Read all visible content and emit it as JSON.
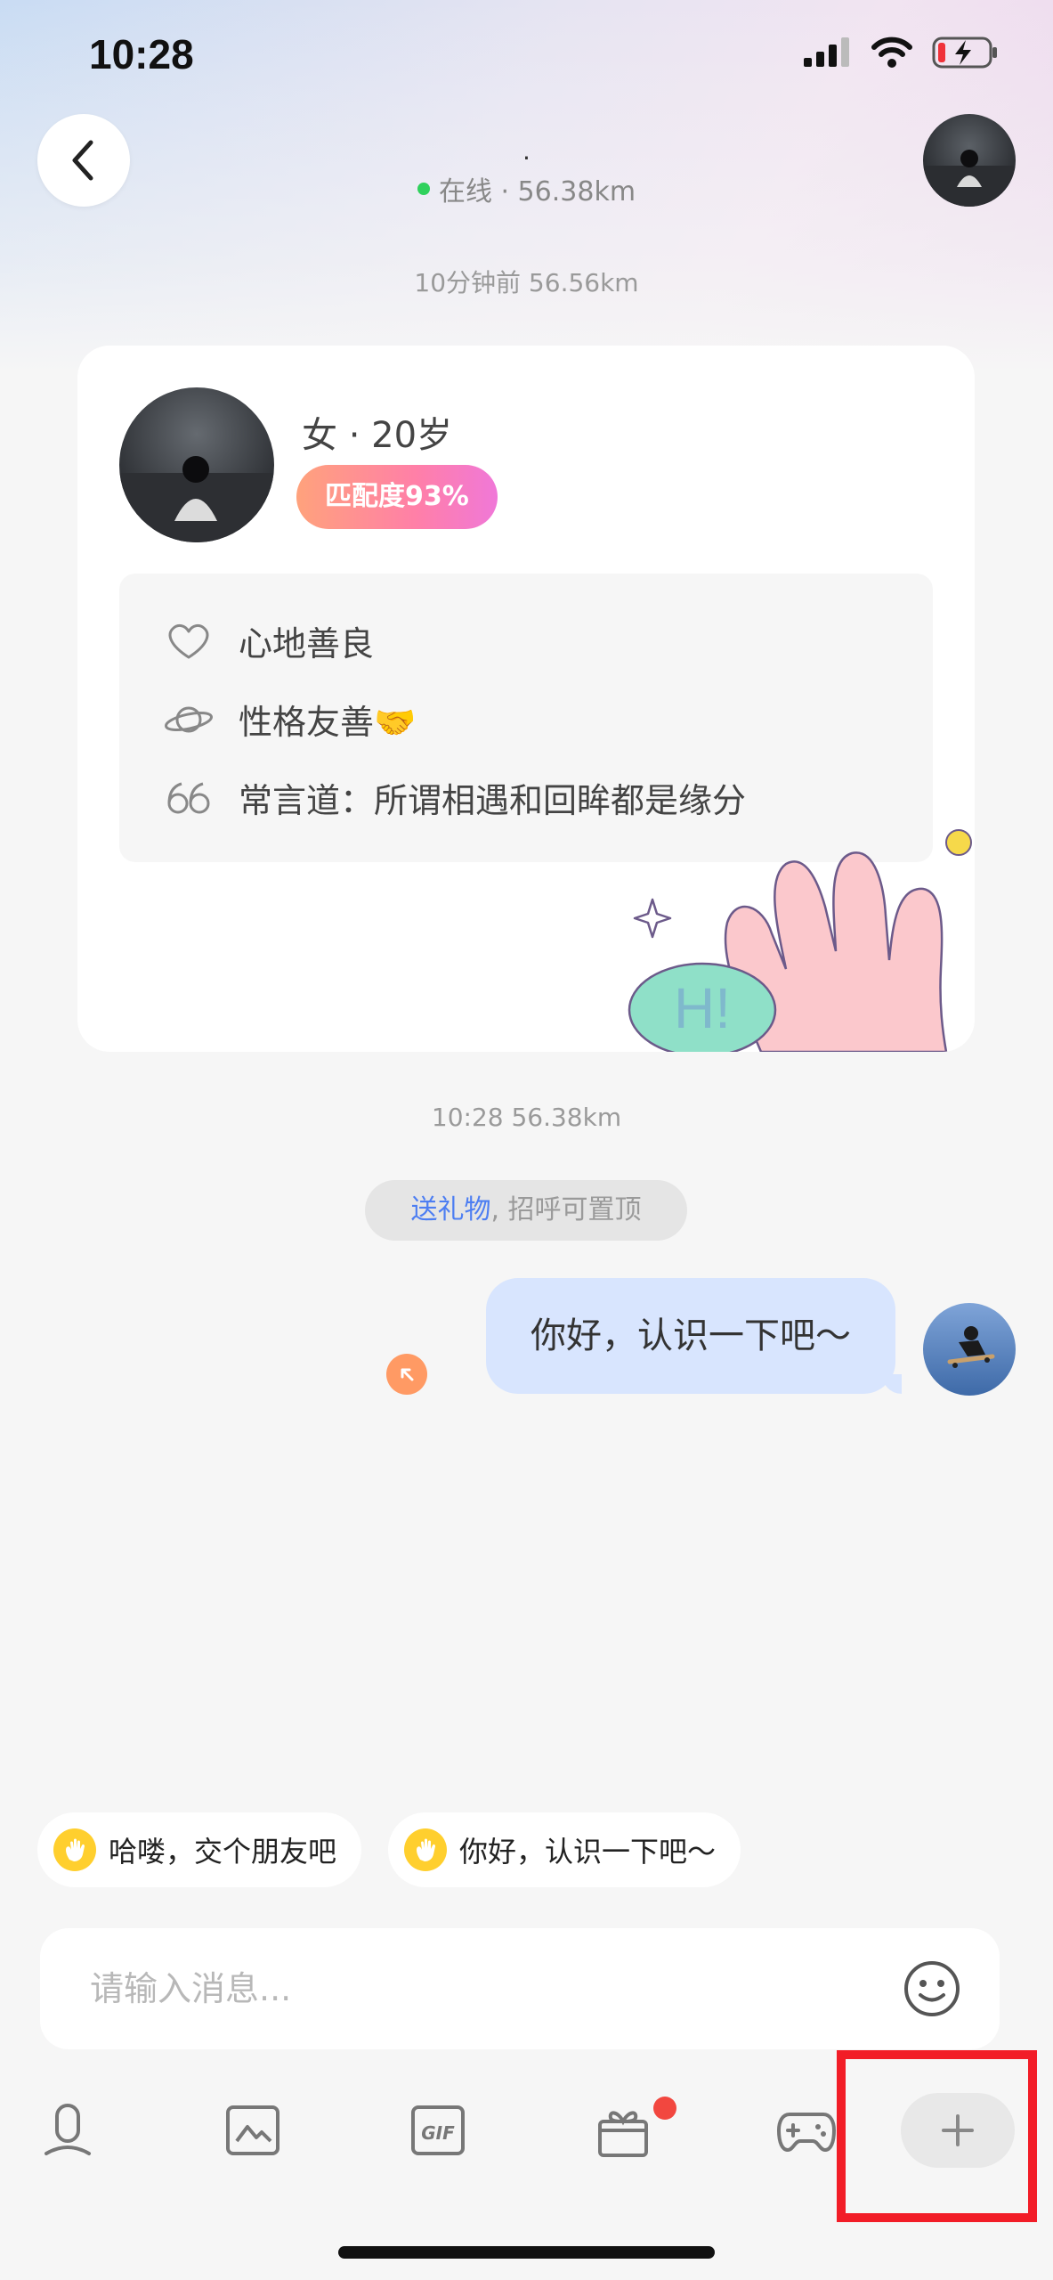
{
  "status_bar": {
    "time": "10:28"
  },
  "header": {
    "title": ".",
    "status_text": "在线 · 56.38km"
  },
  "timestamps": {
    "first": "10分钟前   56.56km",
    "second": "10:28   56.38km"
  },
  "profile_card": {
    "gender_age": "女 · 20岁",
    "match": "匹配度93%",
    "traits": [
      {
        "icon": "heart-icon",
        "text": "心地善良"
      },
      {
        "icon": "planet-icon",
        "text": "性格友善🤝"
      },
      {
        "icon": "quote-icon",
        "text": "常言道：所谓相遇和回眸都是缘分"
      }
    ],
    "sticker_text": "H!"
  },
  "gift_hint": {
    "link": "送礼物",
    "rest": ", 招呼可置顶"
  },
  "message": {
    "text": "你好，认识一下吧～"
  },
  "quick_replies": [
    {
      "text": "哈喽，交个朋友吧"
    },
    {
      "text": "你好，认识一下吧～"
    }
  ],
  "input": {
    "placeholder": "请输入消息..."
  },
  "toolbar": {
    "items": [
      "voice-icon",
      "image-icon",
      "gif-icon",
      "gift-icon",
      "game-icon",
      "plus-icon"
    ]
  },
  "colors": {
    "accent_blue": "#4d7ef2",
    "bubble": "#d8e5fe",
    "online": "#2fd15c",
    "highlight": "#f21d27"
  }
}
